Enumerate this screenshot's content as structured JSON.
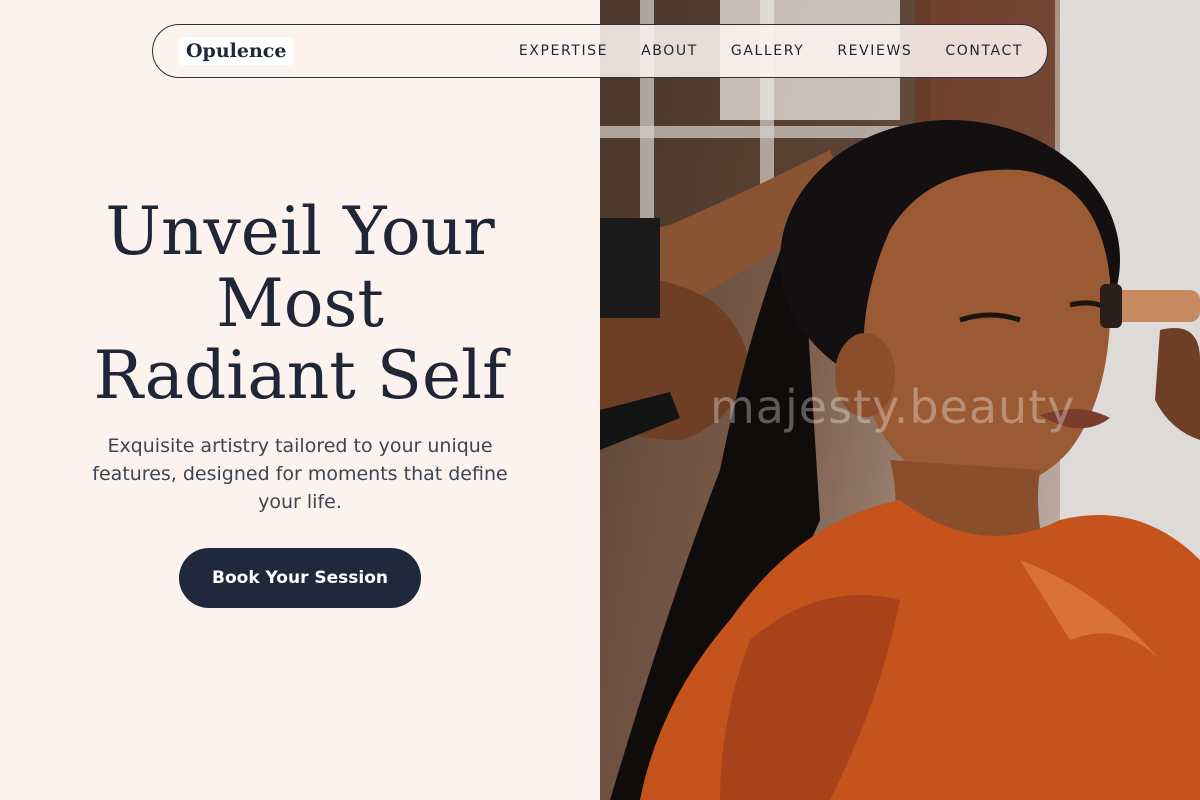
{
  "brand": {
    "logo": "Opulence"
  },
  "nav": {
    "links": [
      "EXPERTISE",
      "ABOUT",
      "GALLERY",
      "REVIEWS",
      "CONTACT"
    ]
  },
  "hero": {
    "title_lines": [
      "Unveil Your",
      "Most",
      "Radiant Self"
    ],
    "subtitle": "Exquisite artistry tailored to your unique features, designed for moments that define your life.",
    "cta_label": "Book Your Session"
  },
  "photo": {
    "watermark": "majesty.beauty"
  },
  "colors": {
    "background": "#fdf3ee",
    "ink": "#1f2637",
    "button": "#1f293b",
    "garment": "#c4531c"
  }
}
